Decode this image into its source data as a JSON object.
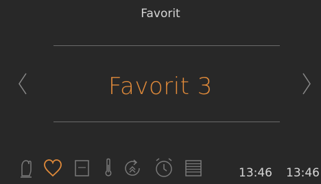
{
  "header": {
    "title": "Favorit"
  },
  "main": {
    "selected_label": "Favorit 3"
  },
  "nav": {
    "prev_icon": "chevron-left-icon",
    "next_icon": "chevron-right-icon"
  },
  "toolbar": {
    "icons": [
      {
        "name": "oven-mitt-icon",
        "active": false
      },
      {
        "name": "heart-icon",
        "active": true
      },
      {
        "name": "square-panel-icon",
        "active": false
      },
      {
        "name": "thermometer-icon",
        "active": false
      },
      {
        "name": "recipe-cycle-icon",
        "active": false
      },
      {
        "name": "alarm-clock-icon",
        "active": false
      },
      {
        "name": "list-lines-icon",
        "active": false
      }
    ]
  },
  "status": {
    "time_1": "13:46",
    "time_2": "13:46"
  },
  "colors": {
    "accent": "#e08a3a",
    "background": "#282828",
    "text": "#d6d6d6",
    "icon": "#7a7a7a"
  }
}
